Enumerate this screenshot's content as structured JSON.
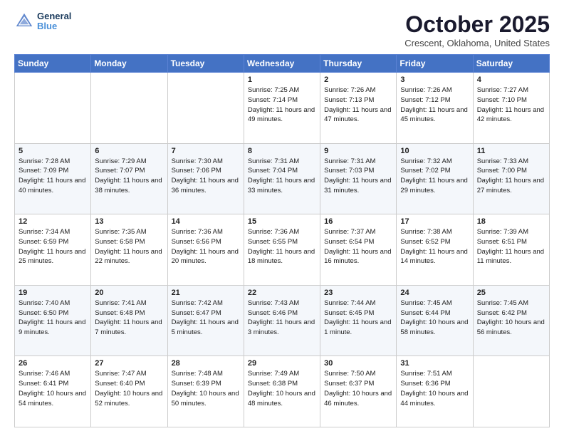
{
  "header": {
    "logo_line1": "General",
    "logo_line2": "Blue",
    "month": "October 2025",
    "location": "Crescent, Oklahoma, United States"
  },
  "days_of_week": [
    "Sunday",
    "Monday",
    "Tuesday",
    "Wednesday",
    "Thursday",
    "Friday",
    "Saturday"
  ],
  "weeks": [
    [
      {
        "day": "",
        "info": ""
      },
      {
        "day": "",
        "info": ""
      },
      {
        "day": "",
        "info": ""
      },
      {
        "day": "1",
        "info": "Sunrise: 7:25 AM\nSunset: 7:14 PM\nDaylight: 11 hours and 49 minutes."
      },
      {
        "day": "2",
        "info": "Sunrise: 7:26 AM\nSunset: 7:13 PM\nDaylight: 11 hours and 47 minutes."
      },
      {
        "day": "3",
        "info": "Sunrise: 7:26 AM\nSunset: 7:12 PM\nDaylight: 11 hours and 45 minutes."
      },
      {
        "day": "4",
        "info": "Sunrise: 7:27 AM\nSunset: 7:10 PM\nDaylight: 11 hours and 42 minutes."
      }
    ],
    [
      {
        "day": "5",
        "info": "Sunrise: 7:28 AM\nSunset: 7:09 PM\nDaylight: 11 hours and 40 minutes."
      },
      {
        "day": "6",
        "info": "Sunrise: 7:29 AM\nSunset: 7:07 PM\nDaylight: 11 hours and 38 minutes."
      },
      {
        "day": "7",
        "info": "Sunrise: 7:30 AM\nSunset: 7:06 PM\nDaylight: 11 hours and 36 minutes."
      },
      {
        "day": "8",
        "info": "Sunrise: 7:31 AM\nSunset: 7:04 PM\nDaylight: 11 hours and 33 minutes."
      },
      {
        "day": "9",
        "info": "Sunrise: 7:31 AM\nSunset: 7:03 PM\nDaylight: 11 hours and 31 minutes."
      },
      {
        "day": "10",
        "info": "Sunrise: 7:32 AM\nSunset: 7:02 PM\nDaylight: 11 hours and 29 minutes."
      },
      {
        "day": "11",
        "info": "Sunrise: 7:33 AM\nSunset: 7:00 PM\nDaylight: 11 hours and 27 minutes."
      }
    ],
    [
      {
        "day": "12",
        "info": "Sunrise: 7:34 AM\nSunset: 6:59 PM\nDaylight: 11 hours and 25 minutes."
      },
      {
        "day": "13",
        "info": "Sunrise: 7:35 AM\nSunset: 6:58 PM\nDaylight: 11 hours and 22 minutes."
      },
      {
        "day": "14",
        "info": "Sunrise: 7:36 AM\nSunset: 6:56 PM\nDaylight: 11 hours and 20 minutes."
      },
      {
        "day": "15",
        "info": "Sunrise: 7:36 AM\nSunset: 6:55 PM\nDaylight: 11 hours and 18 minutes."
      },
      {
        "day": "16",
        "info": "Sunrise: 7:37 AM\nSunset: 6:54 PM\nDaylight: 11 hours and 16 minutes."
      },
      {
        "day": "17",
        "info": "Sunrise: 7:38 AM\nSunset: 6:52 PM\nDaylight: 11 hours and 14 minutes."
      },
      {
        "day": "18",
        "info": "Sunrise: 7:39 AM\nSunset: 6:51 PM\nDaylight: 11 hours and 11 minutes."
      }
    ],
    [
      {
        "day": "19",
        "info": "Sunrise: 7:40 AM\nSunset: 6:50 PM\nDaylight: 11 hours and 9 minutes."
      },
      {
        "day": "20",
        "info": "Sunrise: 7:41 AM\nSunset: 6:48 PM\nDaylight: 11 hours and 7 minutes."
      },
      {
        "day": "21",
        "info": "Sunrise: 7:42 AM\nSunset: 6:47 PM\nDaylight: 11 hours and 5 minutes."
      },
      {
        "day": "22",
        "info": "Sunrise: 7:43 AM\nSunset: 6:46 PM\nDaylight: 11 hours and 3 minutes."
      },
      {
        "day": "23",
        "info": "Sunrise: 7:44 AM\nSunset: 6:45 PM\nDaylight: 11 hours and 1 minute."
      },
      {
        "day": "24",
        "info": "Sunrise: 7:45 AM\nSunset: 6:44 PM\nDaylight: 10 hours and 58 minutes."
      },
      {
        "day": "25",
        "info": "Sunrise: 7:45 AM\nSunset: 6:42 PM\nDaylight: 10 hours and 56 minutes."
      }
    ],
    [
      {
        "day": "26",
        "info": "Sunrise: 7:46 AM\nSunset: 6:41 PM\nDaylight: 10 hours and 54 minutes."
      },
      {
        "day": "27",
        "info": "Sunrise: 7:47 AM\nSunset: 6:40 PM\nDaylight: 10 hours and 52 minutes."
      },
      {
        "day": "28",
        "info": "Sunrise: 7:48 AM\nSunset: 6:39 PM\nDaylight: 10 hours and 50 minutes."
      },
      {
        "day": "29",
        "info": "Sunrise: 7:49 AM\nSunset: 6:38 PM\nDaylight: 10 hours and 48 minutes."
      },
      {
        "day": "30",
        "info": "Sunrise: 7:50 AM\nSunset: 6:37 PM\nDaylight: 10 hours and 46 minutes."
      },
      {
        "day": "31",
        "info": "Sunrise: 7:51 AM\nSunset: 6:36 PM\nDaylight: 10 hours and 44 minutes."
      },
      {
        "day": "",
        "info": ""
      }
    ]
  ]
}
